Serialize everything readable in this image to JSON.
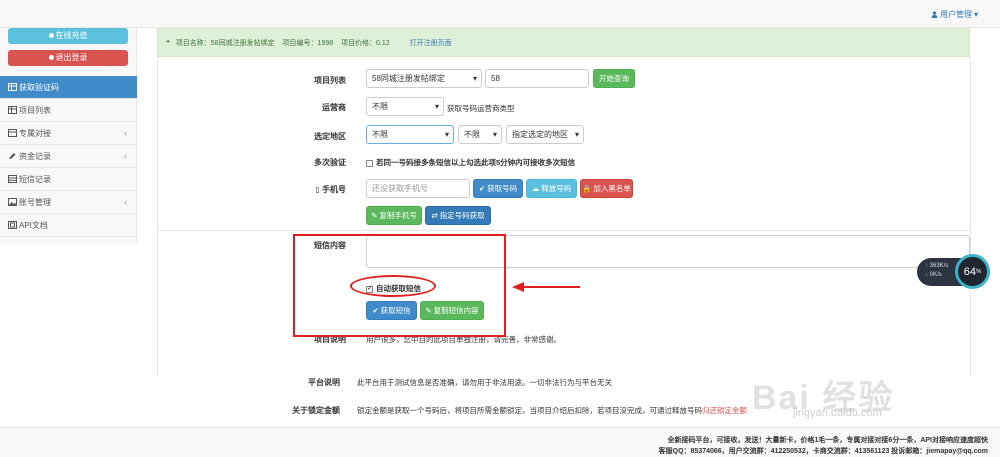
{
  "header": {
    "user_menu": "用户管理"
  },
  "sidebar": {
    "recharge": "在线充值",
    "logout": "退出登录",
    "items": [
      {
        "label": "获取验证码",
        "active": true,
        "has_chevron": false
      },
      {
        "label": "项目列表",
        "active": false,
        "has_chevron": false
      },
      {
        "label": "专属对接",
        "active": false,
        "has_chevron": true
      },
      {
        "label": "资金记录",
        "active": false,
        "has_chevron": true
      },
      {
        "label": "短信记录",
        "active": false,
        "has_chevron": false
      },
      {
        "label": "账号管理",
        "active": false,
        "has_chevron": true
      },
      {
        "label": "API文档",
        "active": false,
        "has_chevron": false
      }
    ]
  },
  "project_info": {
    "name": "项目名称：58同城注册发帖绑定",
    "id": "项目编号：1998",
    "price": "项目价格：0.12",
    "open_link": "打开注册页面"
  },
  "form": {
    "project_list_label": "项目列表",
    "project_select": "58同城注册发帖绑定",
    "project_code": "58",
    "start_query": "开始查询",
    "carrier_label": "运营商",
    "carrier_select": "不限",
    "carrier_hint": "获取号码运营商类型",
    "region_label": "选定地区",
    "region_select1": "不限",
    "region_select2": "不限",
    "region_select3": "指定选定的地区",
    "multi_label": "多次验证",
    "multi_hint": "若同一号码接多条短信以上勾选此项5分钟内可接收多次短信",
    "phone_label": "手机号",
    "phone_placeholder": "还没获取手机号",
    "get_number": "获取号码",
    "release_number": "释放号码",
    "blacklist": "加入黑名单",
    "copy_phone": "复制手机号",
    "specify_number": "指定号码获取",
    "sms_label": "短信内容",
    "auto_get": "自动获取短信",
    "get_sms": "获取短信",
    "copy_sms": "复制短信内容",
    "project_desc_label": "项目说明",
    "project_desc": "用户很多，您中自的此项目单独注册，请完善，非常感谢。",
    "platform_label": "平台说明",
    "platform_desc": "此平台用于测试信息是否准确，请勿用于非法用途。一切非法行为与平台无关",
    "lock_label": "关于锁定金额",
    "lock_desc": "锁定金额是获取一个号码后，将项目所需金额锁定，当项目介绍后扣除，若项目没完成，可通过释放号码",
    "lock_link": "归还锁定金额"
  },
  "footer": {
    "line1": "全新接码平台，可接收，发送！大量新卡，价格1毛一条，专属对接对接6分一条，API对接响应速度超快",
    "line2": "客服QQ：85374066，用户交流群：412250532，卡商交流群：413561123 投诉邮箱：jiemapay@qq.com"
  },
  "widget": {
    "up": "363K/s",
    "down": "0K/s",
    "percent": "64",
    "percent_unit": "%"
  },
  "watermark": {
    "main": "Bai 经验",
    "sub": "jingyan.baidu.com"
  }
}
